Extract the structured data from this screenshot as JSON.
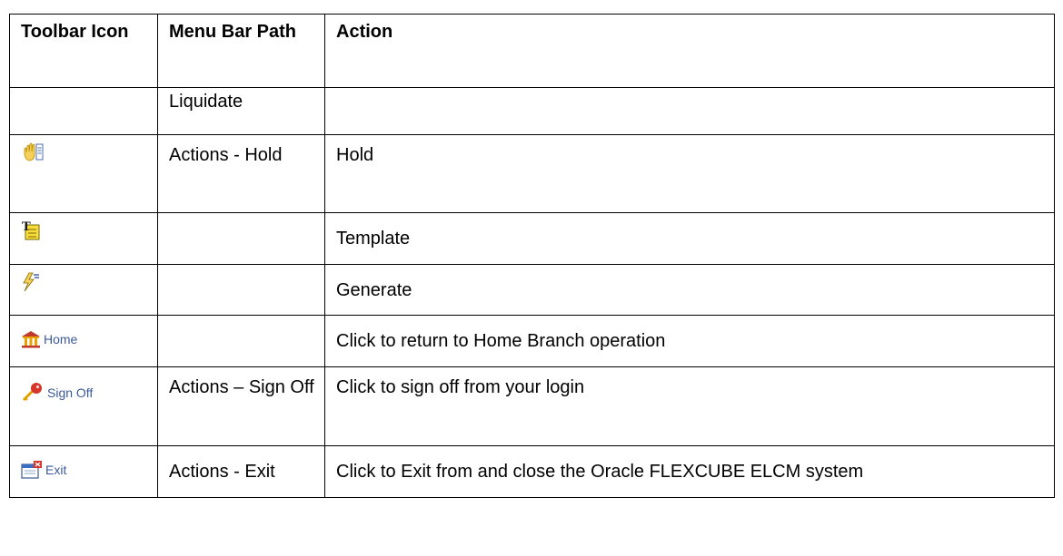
{
  "table": {
    "headers": [
      "Toolbar Icon",
      "Menu Bar Path",
      "Action"
    ],
    "rows": [
      {
        "icon": null,
        "icon_label": "",
        "path": "Liquidate",
        "action": ""
      },
      {
        "icon": "hand-hold-icon",
        "icon_label": "",
        "path": "Actions - Hold",
        "action": "Hold"
      },
      {
        "icon": "template-icon",
        "icon_label": "",
        "path": "",
        "action": "Template"
      },
      {
        "icon": "lightning-generate-icon",
        "icon_label": "",
        "path": "",
        "action": "Generate"
      },
      {
        "icon": "home-bank-icon",
        "icon_label": "Home",
        "path": "",
        "action": "Click to return to Home Branch operation"
      },
      {
        "icon": "key-sign-off-icon",
        "icon_label": "Sign Off",
        "path": "Actions – Sign Off",
        "action": "Click to sign off from your login"
      },
      {
        "icon": "exit-window-icon",
        "icon_label": "Exit",
        "path": "Actions - Exit",
        "action": "Click to Exit from and close the Oracle FLEXCUBE ELCM system"
      }
    ]
  },
  "colors": {
    "border": "#000000",
    "icon_text": "#3a5a9a",
    "icon_gold": "#e8b800",
    "icon_red": "#c0392b"
  }
}
